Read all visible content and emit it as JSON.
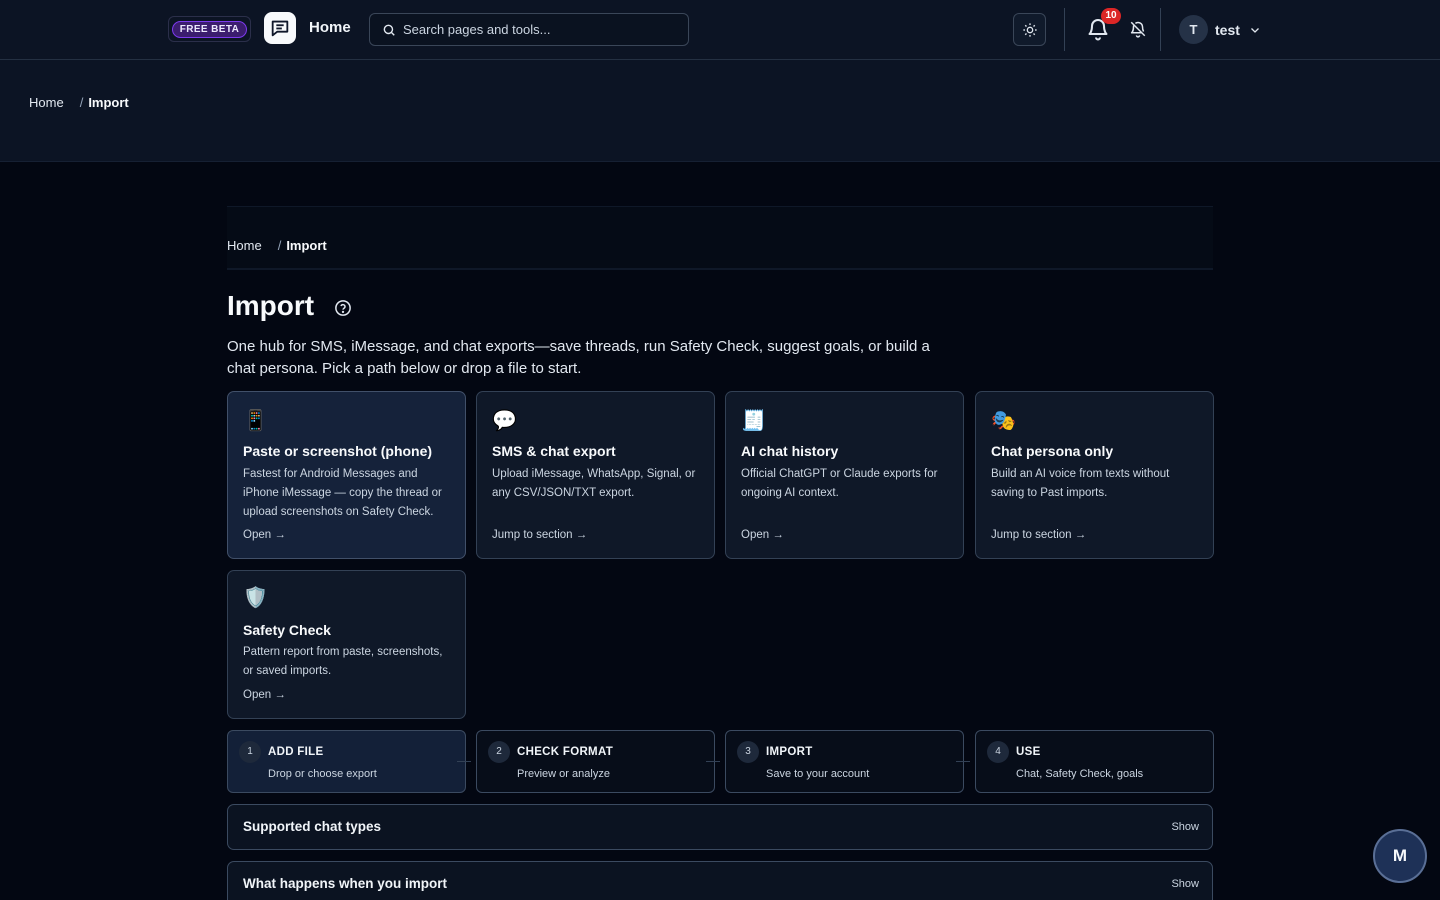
{
  "header": {
    "beta_badge": "FREE BETA",
    "home_label": "Home",
    "search_placeholder": "Search pages and tools...",
    "notification_count": "10",
    "user_initial": "T",
    "user_name": "test"
  },
  "breadcrumb": {
    "home": "Home",
    "separator": "/",
    "current": "Import"
  },
  "page": {
    "title": "Import",
    "lead": "One hub for SMS, iMessage, and chat exports—save threads, run Safety Check, suggest goals, or build a chat persona. Pick a path below or drop a file to start."
  },
  "cards": [
    {
      "emoji": "📱",
      "title": "Paste or screenshot (phone)",
      "desc": "Fastest for Android Messages and iPhone iMessage — copy the thread or upload screenshots on Safety Check.",
      "link": "Open →"
    },
    {
      "emoji": "💬",
      "title": "SMS & chat export",
      "desc": "Upload iMessage, WhatsApp, Signal, or any CSV/JSON/TXT export.",
      "link": "Jump to section →"
    },
    {
      "emoji": "🧾",
      "title": "AI chat history",
      "desc": "Official ChatGPT or Claude exports for ongoing AI context.",
      "link": "Open →"
    },
    {
      "emoji": "🎭",
      "title": "Chat persona only",
      "desc": "Build an AI voice from texts without saving to Past imports.",
      "link": "Jump to section →"
    },
    {
      "emoji": "🛡️",
      "title": "Safety Check",
      "desc": "Pattern report from paste, screenshots, or saved imports.",
      "link": "Open →"
    }
  ],
  "steps": [
    {
      "num": "1",
      "title": "ADD FILE",
      "sub": "Drop or choose export"
    },
    {
      "num": "2",
      "title": "CHECK FORMAT",
      "sub": "Preview or analyze"
    },
    {
      "num": "3",
      "title": "IMPORT",
      "sub": "Save to your account"
    },
    {
      "num": "4",
      "title": "USE",
      "sub": "Chat, Safety Check, goals"
    }
  ],
  "accordions": [
    {
      "title": "Supported chat types",
      "action": "Show"
    },
    {
      "title": "What happens when you import",
      "action": "Show"
    }
  ],
  "fab": {
    "label": "M"
  },
  "colors": {
    "background": "#030712",
    "nav": "#0c1424",
    "card": "#0f1828",
    "accent_purple": "#7c3aed",
    "badge_red": "#dc2626"
  },
  "icons": [
    "logo-icon",
    "search-icon",
    "sun-icon",
    "bell-icon",
    "bell-off-icon",
    "chevron-down-icon",
    "help-circle-icon"
  ]
}
